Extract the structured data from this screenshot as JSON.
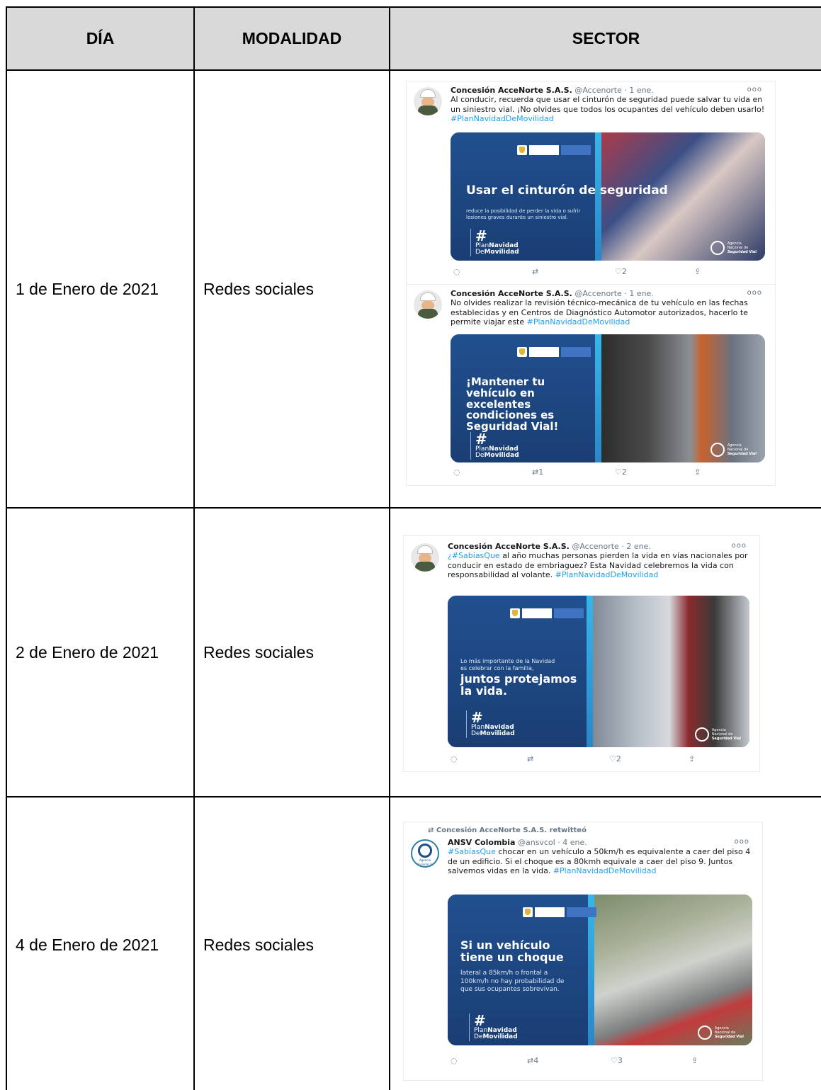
{
  "table": {
    "headers": {
      "day": "DÍA",
      "mode": "MODALIDAD",
      "sector": "SECTOR"
    },
    "rows": [
      {
        "day": "1 de Enero de 2021",
        "mode": "Redes sociales"
      },
      {
        "day": "2 de Enero de 2021",
        "mode": "Redes sociales"
      },
      {
        "day": "4 de Enero de 2021",
        "mode": "Redes sociales"
      }
    ]
  },
  "tweets": [
    {
      "author": "Concesión AcceNorte S.A.S.",
      "handle_date": "@Accenorte · 1 ene.",
      "text": "Al conducir, recuerda que usar el cinturón de seguridad puede salvar tu vida en un siniestro vial. ¡No olvides que todos los ocupantes del vehículo deben usarlo!",
      "hashtag": "#PlanNavidadDeMovilidad",
      "poster_title": "Usar el cinturón de seguridad",
      "poster_sub": "reduce la posibilidad de perder la vida o sufrir lesiones graves durante un siniestro vial.",
      "replies": "",
      "retweets": "",
      "likes": "2"
    },
    {
      "author": "Concesión AcceNorte S.A.S.",
      "handle_date": "@Accenorte · 1 ene.",
      "text": "No olvides realizar la revisión técnico-mecánica de tu vehículo en las fechas establecidas y en Centros de Diagnóstico Automotor autorizados, hacerlo te permite viajar este",
      "hashtag": "#PlanNavidadDeMovilidad",
      "poster_title": "¡Mantener tu vehículo en excelentes condiciones es Seguridad Vial!",
      "replies": "",
      "retweets": "1",
      "likes": "2"
    },
    {
      "author": "Concesión AcceNorte S.A.S.",
      "handle_date": "@Accenorte · 2 ene.",
      "hashtag_lead": "¿#SabíasQue",
      "text": "al año muchas personas pierden la vida en vías nacionales por conducir en estado de embriaguez? Esta Navidad celebremos la vida con responsabilidad al volante.",
      "hashtag": "#PlanNavidadDeMovilidad",
      "poster_sub": "Lo más importante de la Navidad es celebrar con la familia,",
      "poster_title": "juntos protejamos la vida.",
      "replies": "",
      "retweets": "",
      "likes": "2"
    },
    {
      "retweeted_by": "Concesión AcceNorte S.A.S. retwitteó",
      "author": "ANSV Colombia",
      "handle_date": "@ansvcol · 4 ene.",
      "hashtag_lead": "#SabíasQue",
      "text": "chocar en un vehículo a 50km/h es equivalente a caer del piso 4 de un edificio. Si el choque es a 80kmh equivale a caer del piso 9. Juntos salvemos vidas en la vida.",
      "hashtag": "#PlanNavidadDeMovilidad",
      "poster_title": "Si un vehículo tiene un choque",
      "poster_sub": "lateral a 85km/h o frontal a 100km/h no hay probabilidad de que sus ocupantes sobrevivan.",
      "replies": "",
      "retweets": "4",
      "likes": "3"
    }
  ],
  "poster_common": {
    "hash_line1": "Plan",
    "hash_line1_bold": "Navidad",
    "hash_line2": "De",
    "hash_line2_bold": "Movilidad",
    "agency_line1": "Agencia",
    "agency_line2": "Nacional de",
    "agency_line3": "Seguridad Vial",
    "ansv_mini": "Agencia Nacional de Seguridad Vial"
  }
}
